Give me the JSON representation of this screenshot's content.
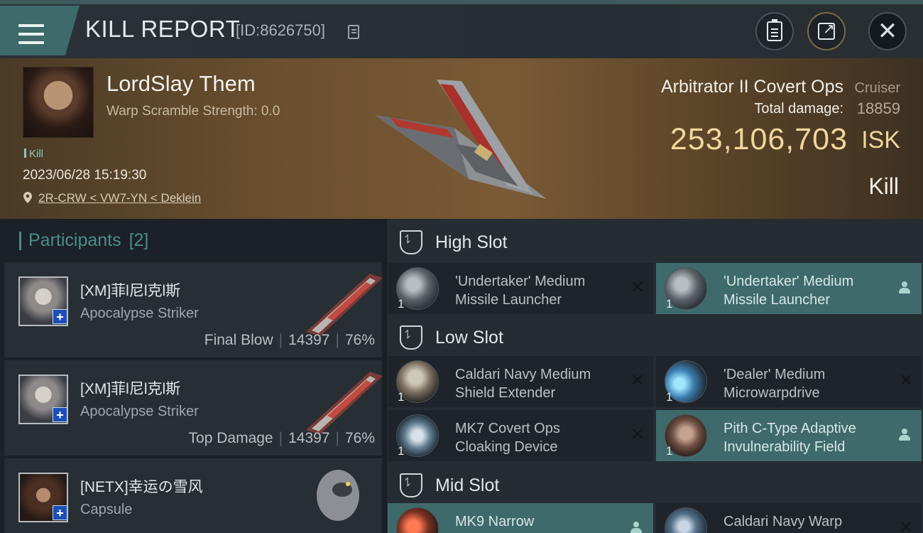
{
  "header": {
    "title": "KILL REPORT",
    "report_id": "[ID:8626750]",
    "icons": [
      "menu-icon",
      "copy-icon",
      "clipboard-icon",
      "share-icon",
      "close-icon"
    ]
  },
  "victim": {
    "pilot_name": "LordSlay Them",
    "warp_scramble": "Warp Scramble Strength: 0.0",
    "kill_tag": "Kill",
    "timestamp": "2023/06/28 15:19:30",
    "location": "2R-CRW < VW7-YN < Deklein",
    "ship_name": "Arbitrator II Covert Ops",
    "ship_class": "Cruiser",
    "total_damage_label": "Total damage:",
    "total_damage": "18859",
    "isk_value": "253,106,703",
    "isk_unit": "ISK",
    "result": "Kill"
  },
  "participants": {
    "label": "Participants",
    "count": "[2]",
    "rows": [
      {
        "name": "[XM]菲l尼l克l斯",
        "ship": "Apocalypse Striker",
        "role": "Final Blow",
        "damage": "14397",
        "percent": "76%"
      },
      {
        "name": "[XM]菲l尼l克l斯",
        "ship": "Apocalypse Striker",
        "role": "Top Damage",
        "damage": "14397",
        "percent": "76%"
      },
      {
        "name": "[NETX]幸运の雪风",
        "ship": "Capsule"
      }
    ]
  },
  "slots": {
    "high": {
      "title": "High Slot",
      "modules": [
        {
          "line1": "'Undertaker' Medium",
          "line2": "Missile Launcher",
          "qty": "1",
          "status": "destroyed"
        },
        {
          "line1": "'Undertaker' Medium",
          "line2": "Missile Launcher",
          "qty": "1",
          "status": "dropped"
        }
      ]
    },
    "low": {
      "title": "Low Slot",
      "modules": [
        {
          "line1": "Caldari Navy Medium",
          "line2": "Shield Extender",
          "qty": "1",
          "status": "destroyed"
        },
        {
          "line1": "'Dealer' Medium",
          "line2": "Microwarpdrive",
          "qty": "1",
          "status": "destroyed"
        },
        {
          "line1": "MK7 Covert Ops",
          "line2": "Cloaking Device",
          "qty": "1",
          "status": "destroyed"
        },
        {
          "line1": "Pith C-Type Adaptive",
          "line2": "Invulnerability Field",
          "qty": "1",
          "status": "dropped"
        }
      ]
    },
    "mid": {
      "title": "Mid Slot",
      "modules": [
        {
          "line1": "MK9 Narrow",
          "status": "dropped"
        },
        {
          "line1": "Caldari Navy Warp",
          "status": "destroyed"
        }
      ]
    }
  },
  "colors": {
    "accent_teal": "#3e6a6b",
    "isk_gold": "#f0d79a",
    "participants_teal": "#4a8c8c",
    "plus_blue": "#1a4fb8"
  }
}
